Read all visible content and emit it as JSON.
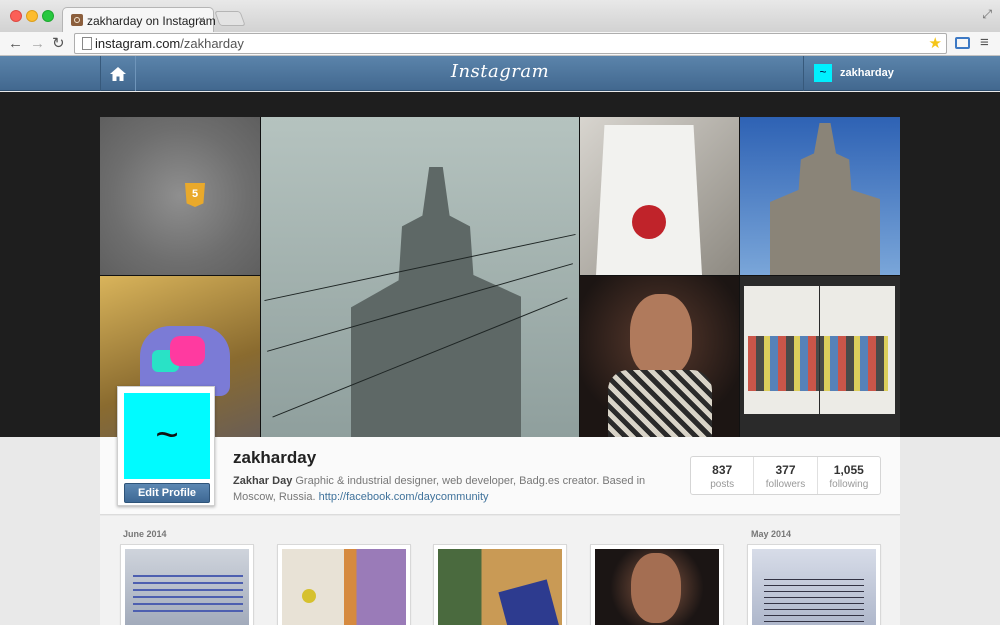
{
  "browser": {
    "tab_title": "zakharday on Instagram",
    "tab_close": "×",
    "url_domain": "instagram.com",
    "url_path": "/zakharday",
    "back_glyph": "←",
    "forward_glyph": "→",
    "reload_glyph": "↻",
    "star_glyph": "★",
    "menu_glyph": "≡",
    "resize_glyph": "⤢"
  },
  "header": {
    "logo": "Instagram",
    "user_avatar_glyph": "~",
    "username": "zakharday",
    "accent_color": "#4d77a0"
  },
  "cover": {
    "badge_glyph": "5"
  },
  "profile": {
    "avatar_glyph": "~",
    "edit_button": "Edit Profile",
    "username": "zakharday",
    "full_name": "Zakhar Day",
    "bio": "Graphic & industrial designer, web developer, Badg.es creator. Based in Moscow, Russia.",
    "link": "http://facebook.com/daycommunity",
    "stats": [
      {
        "value": "837",
        "label": "posts"
      },
      {
        "value": "377",
        "label": "followers"
      },
      {
        "value": "1,055",
        "label": "following"
      }
    ]
  },
  "grid": {
    "months": [
      "June 2014",
      "May 2014"
    ]
  }
}
